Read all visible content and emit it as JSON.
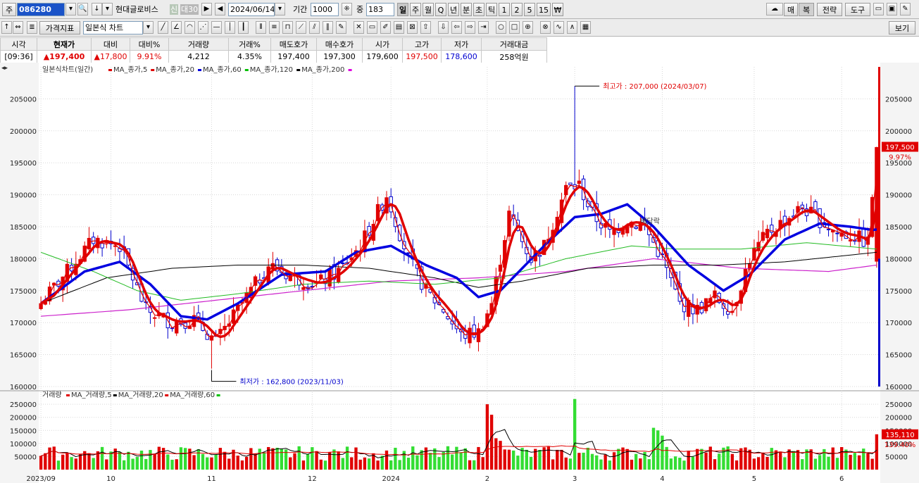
{
  "toolbar": {
    "market_tab": "주",
    "code": "086280",
    "name": "현대글로비스",
    "badge_credit": "신",
    "badge_margin": "대30",
    "date": "2024/06/14",
    "period_label": "기간",
    "period_value": "1000",
    "count_label": "중",
    "count_value": "183",
    "intervals": [
      "일",
      "주",
      "월",
      "Q",
      "년",
      "분",
      "초",
      "틱",
      "1",
      "2",
      "5",
      "15",
      "₩"
    ],
    "right_buttons": [
      "매",
      "복",
      "전략",
      "도구"
    ],
    "indicator_btn": "가격지표",
    "chart_type": "일본식 차트",
    "view_btn": "보기"
  },
  "info": {
    "headers": [
      "시각",
      "현재가",
      "대비",
      "대비%",
      "거래량",
      "거래%",
      "매도호가",
      "매수호가",
      "시가",
      "고가",
      "저가",
      "거래대금"
    ],
    "values": [
      "[09:36]",
      "▲197,400",
      "▲17,800",
      "9.91%",
      "4,212",
      "4.35%",
      "197,400",
      "197,300",
      "179,600",
      "197,500",
      "178,600",
      "258억원"
    ]
  },
  "price_legend": {
    "title": "일본식차트(일간)",
    "items": [
      {
        "label": "MA_종가,5",
        "color": "#e00000"
      },
      {
        "label": "MA_종가,20",
        "color": "#e00000"
      },
      {
        "label": "MA_종가,60",
        "color": "#0000e0"
      },
      {
        "label": "MA_종가,120",
        "color": "#00c000"
      },
      {
        "label": "MA_종가,200",
        "color": "#000000"
      }
    ],
    "end_color": "#e000e0"
  },
  "volume_legend": {
    "title": "거래량",
    "items": [
      {
        "label": "MA_거래량,5",
        "color": "#e00000"
      },
      {
        "label": "MA_거래량,20",
        "color": "#000000"
      },
      {
        "label": "MA_거래량,60",
        "color": "#e00000"
      }
    ],
    "end_color": "#00c000"
  },
  "annotations": {
    "high": "최고가 : 207,000 (2024/03/07)",
    "low": "최저가 : 162,800 (2023/11/03)",
    "mid_text": "배당락",
    "price_tag": "197,500",
    "price_pct": "9.97%",
    "vol_tag": "135,110",
    "vol_pct": "139.40%"
  },
  "colors": {
    "up": "#e00000",
    "down": "#0000cc",
    "vol_up": "#e00000",
    "vol_down": "#33dd33",
    "ma5": "#e00000",
    "ma20": "#e00000",
    "ma60": "#0000e0",
    "ma120": "#22bb22",
    "ma200": "#000000",
    "ma_long": "#cc22cc"
  },
  "chart_data": {
    "type": "line",
    "price_axis": {
      "ylim": [
        160000,
        210000
      ],
      "ticks": [
        160000,
        165000,
        170000,
        175000,
        180000,
        185000,
        190000,
        195000,
        200000,
        205000
      ]
    },
    "volume_axis": {
      "ylim": [
        0,
        280000
      ],
      "ticks": [
        50000,
        100000,
        150000,
        200000,
        250000
      ]
    },
    "x_month_labels": [
      {
        "i": 0,
        "label": "2023/09"
      },
      {
        "i": 16,
        "label": "10"
      },
      {
        "i": 39,
        "label": "11"
      },
      {
        "i": 62,
        "label": "12"
      },
      {
        "i": 80,
        "label": "2024"
      },
      {
        "i": 102,
        "label": "2"
      },
      {
        "i": 122,
        "label": "3"
      },
      {
        "i": 142,
        "label": "4"
      },
      {
        "i": 163,
        "label": "5"
      },
      {
        "i": 183,
        "label": "6"
      }
    ],
    "close_anchors": [
      [
        0,
        173000
      ],
      [
        6,
        178000
      ],
      [
        12,
        183000
      ],
      [
        18,
        182000
      ],
      [
        24,
        172000
      ],
      [
        30,
        170000
      ],
      [
        35,
        170500
      ],
      [
        40,
        167000
      ],
      [
        45,
        172000
      ],
      [
        52,
        179000
      ],
      [
        58,
        177000
      ],
      [
        63,
        176000
      ],
      [
        68,
        178000
      ],
      [
        73,
        182000
      ],
      [
        79,
        190000
      ],
      [
        84,
        180000
      ],
      [
        88,
        175000
      ],
      [
        92,
        172000
      ],
      [
        96,
        168000
      ],
      [
        100,
        168500
      ],
      [
        103,
        173000
      ],
      [
        107,
        187000
      ],
      [
        112,
        180000
      ],
      [
        115,
        182000
      ],
      [
        120,
        191000
      ],
      [
        123,
        191500
      ],
      [
        126,
        187000
      ],
      [
        130,
        184000
      ],
      [
        134,
        186000
      ],
      [
        138,
        185000
      ],
      [
        142,
        180000
      ],
      [
        146,
        173000
      ],
      [
        150,
        172000
      ],
      [
        154,
        174000
      ],
      [
        158,
        172000
      ],
      [
        162,
        180000
      ],
      [
        166,
        184000
      ],
      [
        170,
        186000
      ],
      [
        174,
        188000
      ],
      [
        178,
        186000
      ],
      [
        182,
        184000
      ],
      [
        186,
        183500
      ],
      [
        189,
        182500
      ],
      [
        191,
        197400
      ]
    ],
    "ma60_anchors": [
      [
        0,
        173000
      ],
      [
        10,
        178000
      ],
      [
        18,
        179500
      ],
      [
        25,
        176000
      ],
      [
        32,
        171000
      ],
      [
        38,
        170500
      ],
      [
        45,
        173000
      ],
      [
        55,
        177500
      ],
      [
        65,
        178000
      ],
      [
        72,
        181000
      ],
      [
        80,
        182000
      ],
      [
        88,
        179000
      ],
      [
        95,
        177000
      ],
      [
        100,
        174000
      ],
      [
        105,
        175000
      ],
      [
        115,
        182000
      ],
      [
        122,
        186500
      ],
      [
        128,
        187000
      ],
      [
        134,
        188500
      ],
      [
        140,
        185000
      ],
      [
        148,
        179000
      ],
      [
        156,
        175000
      ],
      [
        162,
        177500
      ],
      [
        170,
        183000
      ],
      [
        178,
        185500
      ],
      [
        185,
        185000
      ],
      [
        190,
        184500
      ]
    ],
    "ma120_anchors": [
      [
        0,
        181000
      ],
      [
        12,
        178000
      ],
      [
        22,
        175000
      ],
      [
        32,
        173500
      ],
      [
        45,
        174500
      ],
      [
        60,
        176000
      ],
      [
        75,
        176500
      ],
      [
        90,
        176000
      ],
      [
        105,
        177000
      ],
      [
        120,
        180000
      ],
      [
        135,
        182000
      ],
      [
        145,
        181500
      ],
      [
        160,
        181500
      ],
      [
        175,
        182500
      ],
      [
        191,
        181500
      ]
    ],
    "ma200_anchors": [
      [
        0,
        173000
      ],
      [
        15,
        177000
      ],
      [
        30,
        178500
      ],
      [
        45,
        179000
      ],
      [
        60,
        179000
      ],
      [
        75,
        178500
      ],
      [
        90,
        177000
      ],
      [
        100,
        175500
      ],
      [
        110,
        176500
      ],
      [
        125,
        178500
      ],
      [
        140,
        179000
      ],
      [
        155,
        179000
      ],
      [
        170,
        179500
      ],
      [
        191,
        181000
      ]
    ],
    "ma_long_anchors": [
      [
        0,
        171000
      ],
      [
        20,
        172000
      ],
      [
        40,
        173500
      ],
      [
        60,
        175000
      ],
      [
        80,
        176500
      ],
      [
        100,
        177000
      ],
      [
        120,
        178000
      ],
      [
        140,
        180000
      ],
      [
        160,
        178500
      ],
      [
        180,
        178000
      ],
      [
        191,
        179000
      ]
    ],
    "volume_base": 62000,
    "volume_spikes": [
      [
        102,
        250000
      ],
      [
        103,
        210000
      ],
      [
        104,
        120000
      ],
      [
        122,
        270000
      ],
      [
        140,
        160000
      ],
      [
        141,
        150000
      ],
      [
        142,
        130000
      ],
      [
        105,
        110000
      ],
      [
        191,
        135110
      ]
    ],
    "n_days": 192,
    "seed": 7
  }
}
